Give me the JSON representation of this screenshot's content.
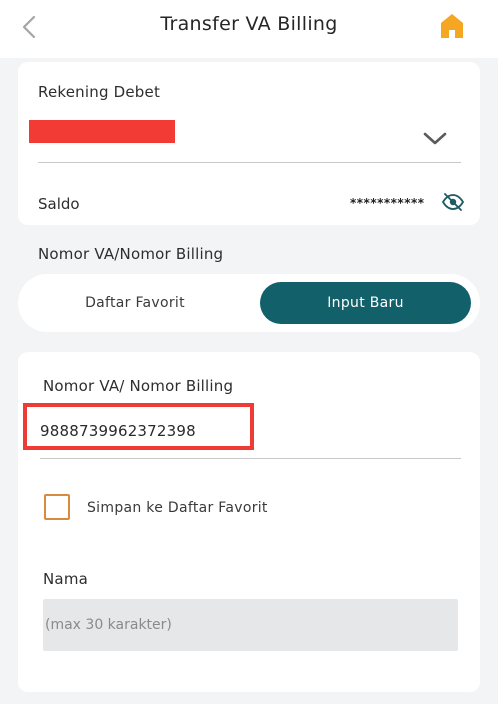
{
  "header": {
    "title": "Transfer VA Billing",
    "back_icon": "chevron-left-icon",
    "home_icon": "home-icon"
  },
  "account": {
    "label": "Rekening Debet",
    "selected_account": "",
    "saldo_label": "Saldo",
    "saldo_value": "***********",
    "visibility_icon": "eye-slash-icon"
  },
  "va_section": {
    "label": "Nomor VA/Nomor Billing",
    "tabs": [
      {
        "label": "Daftar Favorit",
        "active": false
      },
      {
        "label": "Input Baru",
        "active": true
      }
    ]
  },
  "form": {
    "va_label": "Nomor VA/ Nomor Billing",
    "va_value": "9888739962372398",
    "save_favorite_label": "Simpan ke Daftar Favorit",
    "save_favorite_checked": false,
    "nama_label": "Nama",
    "nama_placeholder": "(max 30 karakter)",
    "nama_value": ""
  },
  "colors": {
    "accent": "#11606a",
    "home_icon": "#f5a623",
    "highlight": "#ef3b35",
    "checkbox_border": "#d88b3f",
    "background": "#f3f4f5"
  }
}
